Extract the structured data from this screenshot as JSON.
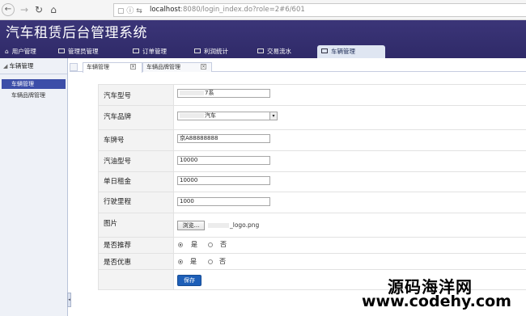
{
  "browser": {
    "url_host": "localhost",
    "url_rest": ":8080/login_index.do?role=2#6/601"
  },
  "app": {
    "title": "汽车租赁后台管理系统",
    "tabs": [
      {
        "label": "用户管理"
      },
      {
        "label": "管理员管理"
      },
      {
        "label": "订单管理"
      },
      {
        "label": "利润统计"
      },
      {
        "label": "交易流水"
      },
      {
        "label": "车辆管理"
      }
    ]
  },
  "sidebar": {
    "heading": "车辆管理",
    "items": [
      {
        "label": "车辆管理"
      },
      {
        "label": "车辆品牌管理"
      }
    ]
  },
  "page_tabs": [
    {
      "label": "车辆管理"
    },
    {
      "label": "车辆品牌管理"
    }
  ],
  "form": {
    "labels": {
      "model": "汽车型号",
      "brand": "汽车品牌",
      "plate": "车牌号",
      "fuel": "汽油型号",
      "rent": "单日租金",
      "mileage": "行驶里程",
      "image": "图片",
      "recommend": "是否推荐",
      "discount": "是否优惠"
    },
    "values": {
      "model": "7系",
      "brand": "汽车",
      "plate": "京A88888888",
      "fuel": "10000",
      "rent": "10000",
      "mileage": "1000",
      "file_name": "_logo.png"
    },
    "browse_label": "浏览...",
    "radio_yes": "是",
    "radio_no": "否",
    "save_label": "保存"
  },
  "watermark": {
    "line1": "源码海洋网",
    "line2": "www.codehy.com"
  }
}
